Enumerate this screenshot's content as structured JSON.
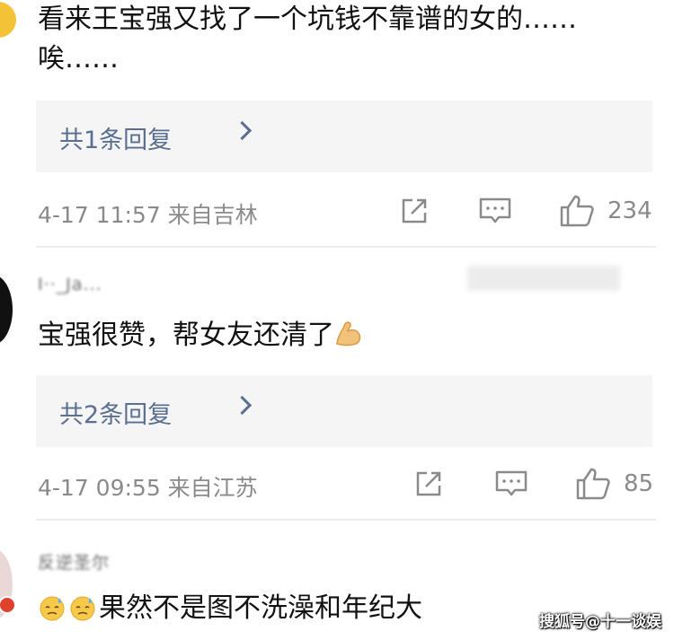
{
  "comments": [
    {
      "text": "看来王宝强又找了一个坑钱不靠谱的女的……唉……",
      "replies_label": "共1条回复",
      "meta": "4-17 11:57 来自吉林",
      "likes": "234"
    },
    {
      "username": "I··_Ja...",
      "text": "宝强很赞，帮女友还清了",
      "emoji": "flexed-biceps-emoji",
      "replies_label": "共2条回复",
      "meta": "4-17 09:55 来自江苏",
      "likes": "85"
    },
    {
      "username": "反逆圣尔",
      "emoji": "sweat-face-emoji",
      "text": "果然不是图不洗澡和年纪大"
    }
  ],
  "watermark": "搜狐号@十一谈娱",
  "colors": {
    "reply_link": "#5a6e8f",
    "meta_gray": "#8a8a8a",
    "reply_bg": "#f5f5f5"
  }
}
